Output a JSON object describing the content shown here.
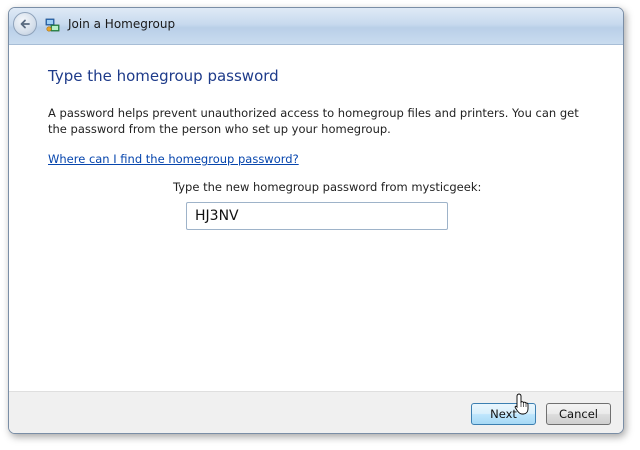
{
  "window": {
    "title": "Join a Homegroup",
    "app_icon": "homegroup-icon",
    "back_icon": "back-arrow-icon"
  },
  "content": {
    "heading": "Type the homegroup password",
    "description": "A password helps prevent unauthorized access to homegroup files and printers. You can get the password from the person who set up your homegroup.",
    "help_link": "Where can I find the homegroup password?",
    "prompt_label": "Type the new homegroup password from mysticgeek:",
    "password_value": "HJ3NV"
  },
  "footer": {
    "next_label": "Next",
    "cancel_label": "Cancel"
  },
  "colors": {
    "heading": "#1e3b8a",
    "link": "#0645ad",
    "titlebar": "#c7d9ee"
  }
}
